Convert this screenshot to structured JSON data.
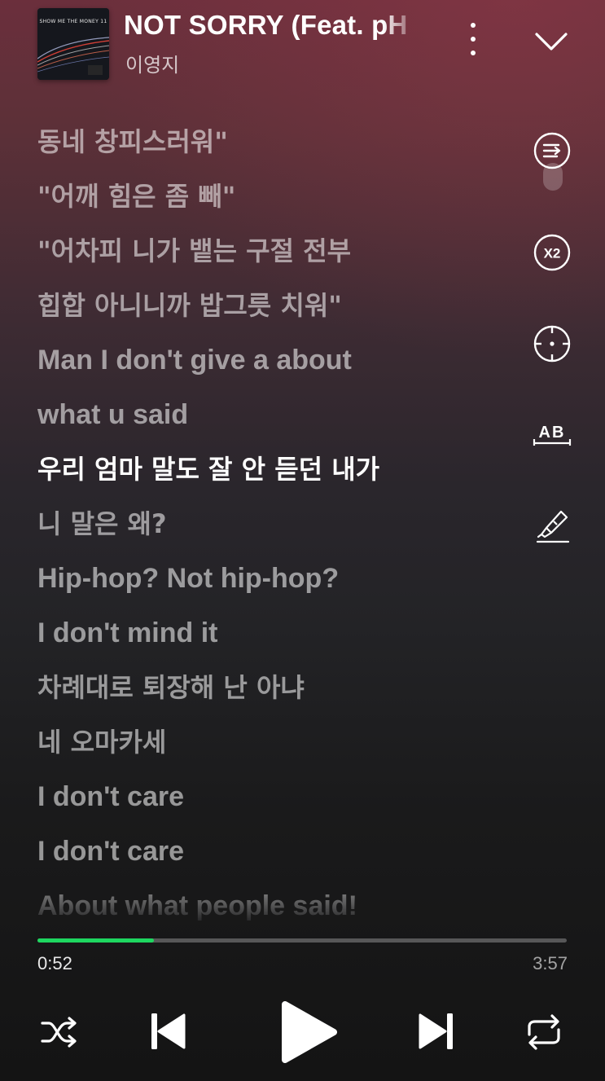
{
  "header": {
    "track_title": "NOT SORRY (Feat. pH",
    "artist": "이영지",
    "album_art_text": "SHOW ME THE MONEY 11"
  },
  "lyrics": [
    {
      "text": "동네 창피스러워\"",
      "lang": "ko",
      "current": false
    },
    {
      "text": "\"어깨 힘은 좀 빼\"",
      "lang": "ko",
      "current": false
    },
    {
      "text": "\"어차피 니가 뱉는 구절 전부",
      "lang": "ko",
      "current": false
    },
    {
      "text": "힙합 아니니까 밥그릇 치워\"",
      "lang": "ko",
      "current": false
    },
    {
      "text": "Man I don't give a about",
      "lang": "en",
      "current": false
    },
    {
      "text": "what u said",
      "lang": "en",
      "current": false
    },
    {
      "text": "우리 엄마 말도 잘 안 듣던 내가",
      "lang": "ko",
      "current": true
    },
    {
      "text": "니 말은 왜?",
      "lang": "ko",
      "current": false
    },
    {
      "text": "Hip-hop? Not hip-hop?",
      "lang": "en",
      "current": false
    },
    {
      "text": "I don't mind it",
      "lang": "en",
      "current": false
    },
    {
      "text": "차례대로 퇴장해 난 아냐",
      "lang": "ko",
      "current": false
    },
    {
      "text": "네 오마카세",
      "lang": "ko",
      "current": false
    },
    {
      "text": "I don't care",
      "lang": "en",
      "current": false
    },
    {
      "text": "I don't care",
      "lang": "en",
      "current": false
    },
    {
      "text": "About what people said!",
      "lang": "en",
      "current": false
    }
  ],
  "tools": {
    "speed_label": "X2",
    "translate_label": "AB"
  },
  "playback": {
    "elapsed": "0:52",
    "duration": "3:57",
    "progress_fraction": 0.2194
  },
  "colors": {
    "accent": "#1ed760",
    "background_top": "#6b2f3c",
    "background_bottom": "#141414"
  },
  "icons": {
    "more": "more-vertical-icon",
    "collapse": "chevron-down-icon",
    "queue": "queue-icon",
    "speed": "speed-x2-icon",
    "locate": "crosshair-icon",
    "translate": "translate-ab-icon",
    "highlight": "highlighter-icon",
    "shuffle": "shuffle-icon",
    "previous": "skip-previous-icon",
    "play": "play-icon",
    "next": "skip-next-icon",
    "repeat": "repeat-icon"
  }
}
